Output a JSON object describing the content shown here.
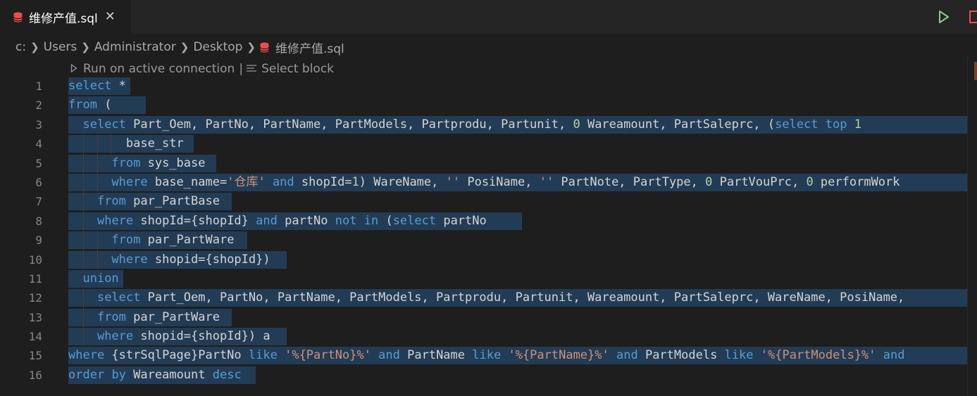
{
  "tab": {
    "label": "维修产值.sql",
    "close": "✕"
  },
  "breadcrumb": [
    "c:",
    "Users",
    "Administrator",
    "Desktop",
    "维修产值.sql"
  ],
  "codelens": {
    "run": "Run on active connection",
    "divider": "|",
    "select": "Select block"
  },
  "colors": {
    "keyword": "#569cd6",
    "string": "#ce9178",
    "number": "#b5cea8",
    "text": "#d4d4d4",
    "selection": "#264f78",
    "run": "#89d185",
    "stop": "#f14c4c",
    "db": "#f14c4c"
  },
  "icons": {
    "file": "database-icon",
    "run": "play-icon",
    "stop": "stop-icon"
  },
  "lines": [
    {
      "n": "1",
      "sel": 88,
      "guides": [],
      "tokens": [
        [
          "kw",
          "select"
        ],
        [
          "t",
          " *"
        ]
      ]
    },
    {
      "n": "2",
      "sel": 110,
      "guides": [],
      "tokens": [
        [
          "kw",
          "from"
        ],
        [
          "t",
          " ("
        ]
      ]
    },
    {
      "n": "3",
      "sel": 1278,
      "guides": [],
      "tokens": [
        [
          "t",
          "  "
        ],
        [
          "kw",
          "select"
        ],
        [
          "t",
          " Part_Oem, PartNo, PartName, PartModels, Partprodu, Partunit, "
        ],
        [
          "num",
          "0"
        ],
        [
          "t",
          " Wareamount, PartSaleprc, ("
        ],
        [
          "kw",
          "select"
        ],
        [
          "t",
          " "
        ],
        [
          "kw",
          "top"
        ],
        [
          "t",
          " "
        ],
        [
          "num",
          "1"
        ]
      ]
    },
    {
      "n": "4",
      "sel": 178,
      "guides": [
        2,
        4,
        6
      ],
      "tokens": [
        [
          "t",
          "        base_str"
        ]
      ]
    },
    {
      "n": "5",
      "sel": 210,
      "guides": [
        2,
        4
      ],
      "tokens": [
        [
          "t",
          "      "
        ],
        [
          "kw",
          "from"
        ],
        [
          "t",
          " sys_base"
        ]
      ]
    },
    {
      "n": "6",
      "sel": 1278,
      "guides": [
        2,
        4
      ],
      "tokens": [
        [
          "t",
          "      "
        ],
        [
          "kw",
          "where"
        ],
        [
          "t",
          " base_name="
        ],
        [
          "str",
          "'仓库'"
        ],
        [
          "t",
          " "
        ],
        [
          "kw",
          "and"
        ],
        [
          "t",
          " shopId="
        ],
        [
          "num",
          "1"
        ],
        [
          "t",
          ") WareName, "
        ],
        [
          "str",
          "''"
        ],
        [
          "t",
          " PosiName, "
        ],
        [
          "str",
          "''"
        ],
        [
          "t",
          " PartNote, PartType, "
        ],
        [
          "num",
          "0"
        ],
        [
          "t",
          " PartVouPrc, "
        ],
        [
          "num",
          "0"
        ],
        [
          "t",
          " performWork"
        ]
      ]
    },
    {
      "n": "7",
      "sel": 232,
      "guides": [
        2
      ],
      "tokens": [
        [
          "t",
          "    "
        ],
        [
          "kw",
          "from"
        ],
        [
          "t",
          " par_PartBase"
        ]
      ]
    },
    {
      "n": "8",
      "sel": 644,
      "guides": [
        2
      ],
      "tokens": [
        [
          "t",
          "    "
        ],
        [
          "kw",
          "where"
        ],
        [
          "t",
          " shopId={shopId} "
        ],
        [
          "kw",
          "and"
        ],
        [
          "t",
          " partNo "
        ],
        [
          "kw",
          "not"
        ],
        [
          "t",
          " "
        ],
        [
          "kw",
          "in"
        ],
        [
          "t",
          " ("
        ],
        [
          "kw",
          "select"
        ],
        [
          "t",
          " partNo"
        ]
      ]
    },
    {
      "n": "9",
      "sel": 254,
      "guides": [
        2,
        4
      ],
      "tokens": [
        [
          "t",
          "      "
        ],
        [
          "kw",
          "from"
        ],
        [
          "t",
          " par_PartWare"
        ]
      ]
    },
    {
      "n": "10",
      "sel": 310,
      "guides": [
        2,
        4
      ],
      "tokens": [
        [
          "t",
          "      "
        ],
        [
          "kw",
          "where"
        ],
        [
          "t",
          " shopid={shopId})"
        ]
      ]
    },
    {
      "n": "11",
      "sel": 78,
      "guides": [],
      "tokens": [
        [
          "t",
          "  "
        ],
        [
          "kw",
          "union"
        ]
      ]
    },
    {
      "n": "12",
      "sel": 1278,
      "guides": [
        2
      ],
      "tokens": [
        [
          "t",
          "    "
        ],
        [
          "kw",
          "select"
        ],
        [
          "t",
          " Part_Oem, PartNo, PartName, PartModels, Partprodu, Partunit, Wareamount, PartSaleprc, WareName, PosiName,"
        ]
      ]
    },
    {
      "n": "13",
      "sel": 232,
      "guides": [
        2
      ],
      "tokens": [
        [
          "t",
          "    "
        ],
        [
          "kw",
          "from"
        ],
        [
          "t",
          " par_PartWare"
        ]
      ]
    },
    {
      "n": "14",
      "sel": 310,
      "guides": [
        2
      ],
      "tokens": [
        [
          "t",
          "    "
        ],
        [
          "kw",
          "where"
        ],
        [
          "t",
          " shopid={shopId}) a"
        ]
      ]
    },
    {
      "n": "15",
      "sel": 1278,
      "guides": [],
      "tokens": [
        [
          "kw",
          "where"
        ],
        [
          "t",
          " {strSqlPage}PartNo "
        ],
        [
          "kw",
          "like"
        ],
        [
          "t",
          " "
        ],
        [
          "str",
          "'%{PartNo}%'"
        ],
        [
          "t",
          " "
        ],
        [
          "kw",
          "and"
        ],
        [
          "t",
          " PartName "
        ],
        [
          "kw",
          "like"
        ],
        [
          "t",
          " "
        ],
        [
          "str",
          "'%{PartName}%'"
        ],
        [
          "t",
          " "
        ],
        [
          "kw",
          "and"
        ],
        [
          "t",
          " PartModels "
        ],
        [
          "kw",
          "like"
        ],
        [
          "t",
          " "
        ],
        [
          "str",
          "'%{PartModels}%'"
        ],
        [
          "t",
          " "
        ],
        [
          "kw",
          "and"
        ]
      ]
    },
    {
      "n": "16",
      "sel": 266,
      "guides": [],
      "tokens": [
        [
          "kw",
          "order"
        ],
        [
          "t",
          " "
        ],
        [
          "kw",
          "by"
        ],
        [
          "t",
          " Wareamount "
        ],
        [
          "kw",
          "desc"
        ]
      ]
    }
  ]
}
